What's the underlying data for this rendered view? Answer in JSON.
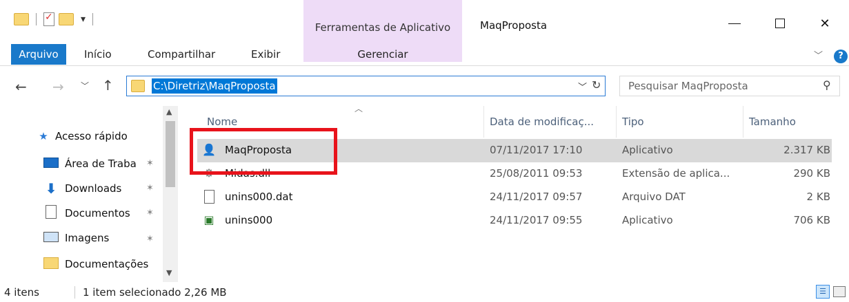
{
  "window": {
    "title": "MaqProposta",
    "context_tab_label": "Ferramentas de Aplicativo"
  },
  "ribbon": {
    "tabs": [
      "Arquivo",
      "Início",
      "Compartilhar",
      "Exibir",
      "Gerenciar"
    ]
  },
  "address": {
    "path": "C:\\Diretriz\\MaqProposta",
    "search_placeholder": "Pesquisar MaqProposta"
  },
  "nav_pane": {
    "items": [
      {
        "label": "Acesso rápido",
        "icon": "star-icon",
        "pinned": false
      },
      {
        "label": "Área de Traba",
        "icon": "desktop-icon",
        "pinned": true
      },
      {
        "label": "Downloads",
        "icon": "download-arrow-icon",
        "pinned": true
      },
      {
        "label": "Documentos",
        "icon": "document-icon",
        "pinned": true
      },
      {
        "label": "Imagens",
        "icon": "image-icon",
        "pinned": true
      },
      {
        "label": "Documentações",
        "icon": "folder-icon",
        "pinned": false
      }
    ]
  },
  "file_list": {
    "columns": [
      "Nome",
      "Data de modificaç...",
      "Tipo",
      "Tamanho"
    ],
    "rows": [
      {
        "name": "MaqProposta",
        "date": "07/11/2017 17:10",
        "type": "Aplicativo",
        "size": "2.317 KB",
        "selected": true,
        "icon": "app-person-icon"
      },
      {
        "name": "Midas.dll",
        "date": "25/08/2011 09:53",
        "type": "Extensão de aplica...",
        "size": "290 KB",
        "selected": false,
        "icon": "dll-gear-icon"
      },
      {
        "name": "unins000.dat",
        "date": "24/11/2017 09:57",
        "type": "Arquivo DAT",
        "size": "2 KB",
        "selected": false,
        "icon": "blank-file-icon"
      },
      {
        "name": "unins000",
        "date": "24/11/2017 09:55",
        "type": "Aplicativo",
        "size": "706 KB",
        "selected": false,
        "icon": "installer-icon"
      }
    ]
  },
  "status": {
    "count": "4 itens",
    "selection": "1 item selecionado  2,26 MB"
  },
  "colors": {
    "accent": "#0078d7",
    "file_tab": "#1979ca",
    "context_tab": "#eedcf7",
    "selection": "#d9d9d9",
    "annotation": "#e8131b"
  }
}
